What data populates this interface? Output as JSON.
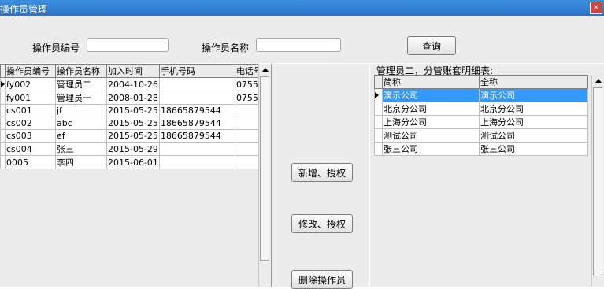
{
  "window": {
    "title": "操作员管理",
    "close_glyph": "×"
  },
  "search": {
    "code_label": "操作员编号",
    "code_value": "",
    "name_label": "操作员名称",
    "name_value": "",
    "query_button": "查询"
  },
  "operators": {
    "columns": [
      "操作员编号",
      "操作员名称",
      "加入时间",
      "手机号码",
      "电话号"
    ],
    "rows": [
      [
        "fy002",
        "管理员二",
        "2004-10-26",
        "",
        "0755-"
      ],
      [
        "fy001",
        "管理员一",
        "2008-01-28",
        "",
        "0755-"
      ],
      [
        "cs001",
        "jf",
        "2015-05-25",
        "18665879544",
        ""
      ],
      [
        "cs002",
        "abc",
        "2015-05-25",
        "18665879544",
        ""
      ],
      [
        "cs003",
        "ef",
        "2015-05-25",
        "18665879544",
        ""
      ],
      [
        "cs004",
        "张三",
        "2015-05-29",
        "",
        ""
      ],
      [
        "0005",
        "李四",
        "2015-06-01",
        "",
        ""
      ]
    ],
    "current_row": 0
  },
  "actions": {
    "add_label": "新增、授权",
    "edit_label": "修改、授权",
    "delete_label": "删除操作员"
  },
  "accounts": {
    "caption": "管理员二，分管账套明细表:",
    "columns": [
      "简称",
      "全称"
    ],
    "rows": [
      [
        "演示公司",
        "演示公司"
      ],
      [
        "北京分公司",
        "北京分公司"
      ],
      [
        "上海分公司",
        "上海分公司"
      ],
      [
        "测试公司",
        "测试公司"
      ],
      [
        "张三公司",
        "张三公司"
      ]
    ],
    "selected_row": 0
  },
  "colors": {
    "selection": "#3399ff",
    "title_bar": "#2a74c9"
  }
}
